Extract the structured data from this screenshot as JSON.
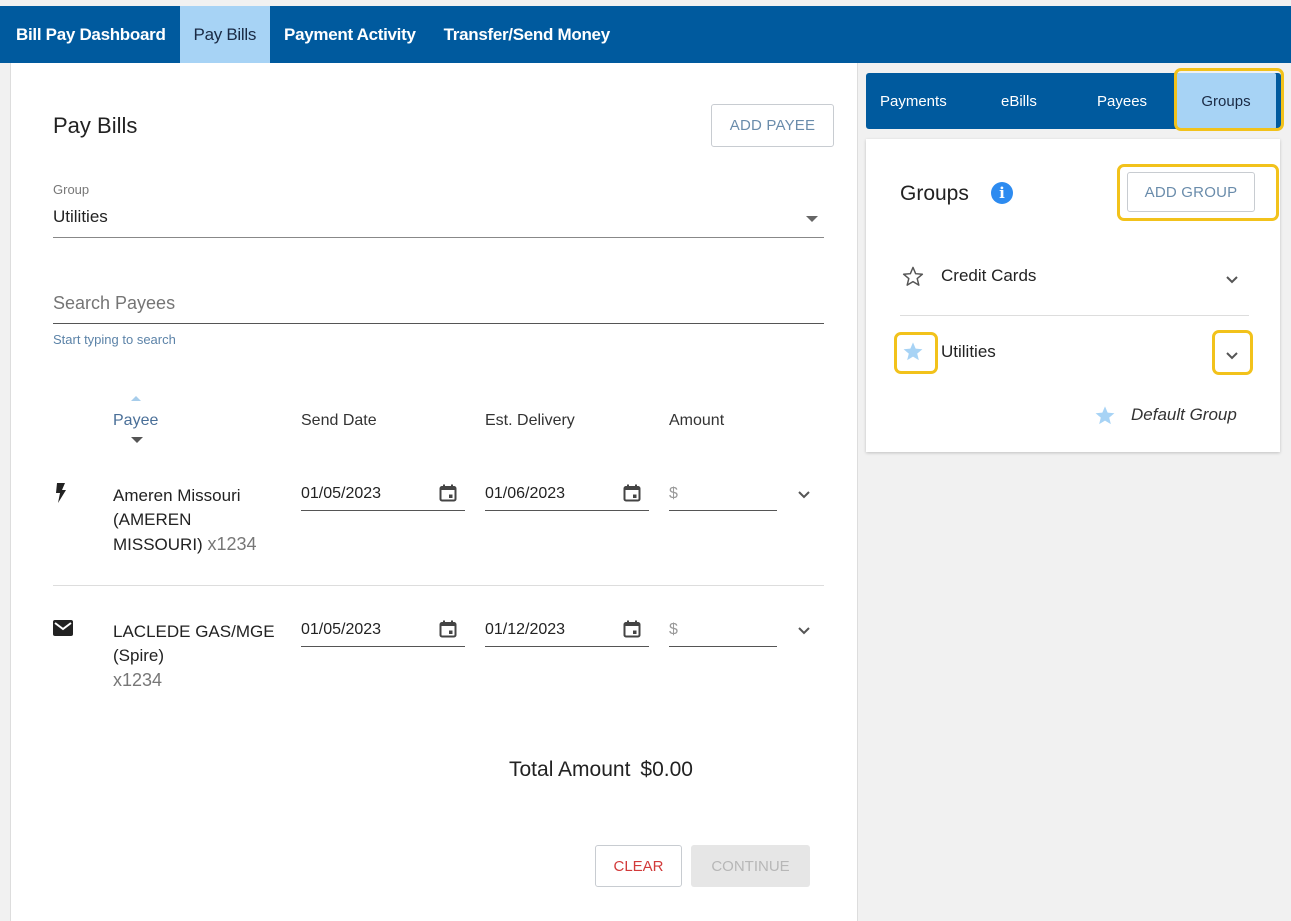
{
  "topnav": {
    "tabs": [
      {
        "label": "Bill Pay Dashboard",
        "active": false
      },
      {
        "label": "Pay Bills",
        "active": true
      },
      {
        "label": "Payment Activity",
        "active": false
      },
      {
        "label": "Transfer/Send Money",
        "active": false
      }
    ]
  },
  "pay_bills": {
    "title": "Pay Bills",
    "add_payee_label": "ADD PAYEE",
    "group_label": "Group",
    "group_value": "Utilities",
    "search_placeholder": "Search Payees",
    "search_hint": "Start typing to search",
    "columns": {
      "payee": "Payee",
      "send_date": "Send Date",
      "est_delivery": "Est. Delivery",
      "amount": "Amount"
    },
    "rows": [
      {
        "icon": "lightning-icon",
        "name": "Ameren Missouri (AMEREN MISSOURI)",
        "account": "x1234",
        "send_date": "01/05/2023",
        "est_delivery": "01/06/2023",
        "amount_prefix": "$"
      },
      {
        "icon": "mail-icon",
        "name": "LACLEDE GAS/MGE (Spire)",
        "account": "x1234",
        "send_date": "01/05/2023",
        "est_delivery": "01/12/2023",
        "amount_prefix": "$"
      }
    ],
    "total_label": "Total Amount",
    "total_value": "$0.00",
    "clear_label": "CLEAR",
    "continue_label": "CONTINUE"
  },
  "side": {
    "tabs": [
      {
        "label": "Payments"
      },
      {
        "label": "eBills"
      },
      {
        "label": "Payees"
      },
      {
        "label": "Groups",
        "active": true
      }
    ],
    "groups_title": "Groups",
    "info_glyph": "i",
    "add_group_label": "ADD GROUP",
    "groups": [
      {
        "name": "Credit Cards",
        "favorite": false
      },
      {
        "name": "Utilities",
        "favorite": true
      }
    ],
    "legend": "Default Group"
  },
  "colors": {
    "nav_blue": "#005a9e",
    "active_tab": "#a7d3f5",
    "highlight": "#f2c21b",
    "star_filled": "#a7d3f5",
    "info_blue": "#2d8bf0",
    "clear_red": "#d23a3a"
  }
}
